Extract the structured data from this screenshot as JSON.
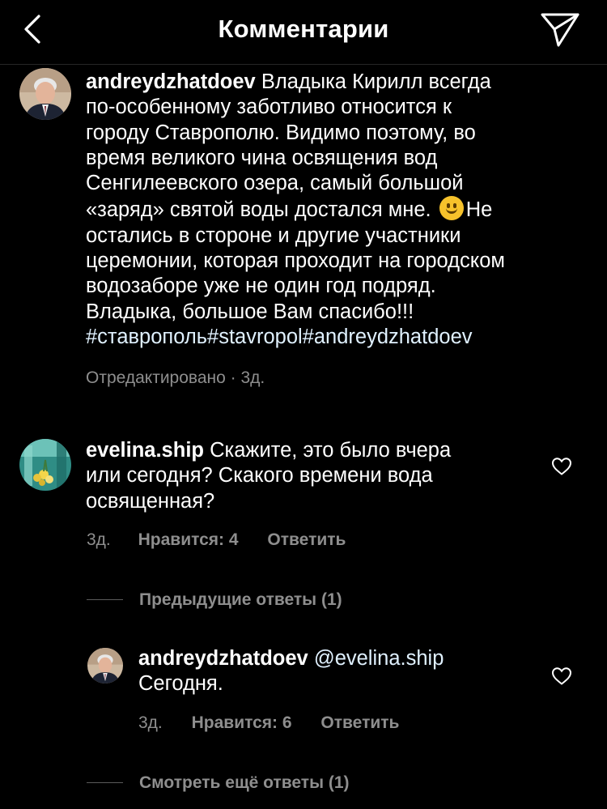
{
  "header": {
    "title": "Комментарии",
    "back_icon": "chevron-left-icon",
    "send_icon": "paper-plane-icon"
  },
  "post": {
    "username": "andreydzhatdoev",
    "text_lines": [
      "Владыка Кирилл всегда",
      "по-особенному заботливо относится к",
      "городу Ставрополю. Видимо поэтому, во",
      "время великого чина освящения вод",
      "Сенгилеевского озера, самый большой",
      "«заряд» святой воды достался мне.",
      "Не",
      "остались в стороне и другие участники",
      "церемонии, которая проходит на городском",
      "водозаборе уже не один год подряд.",
      "Владыка, большое Вам спасибо!!!"
    ],
    "hashtags": [
      "#ставрополь",
      "#stavropol",
      "#andreydzhatdoev"
    ],
    "edited": "Отредактировано",
    "time": "3д."
  },
  "comment": {
    "username": "evelina.ship",
    "text_lines": [
      "Скажите, это было вчера",
      "или сегодня? Скакого времени вода",
      "освященная?"
    ],
    "time": "3д.",
    "likes": "Нравится: 4",
    "reply": "Ответить",
    "previous_replies": "Предыдущие ответы (1)"
  },
  "reply": {
    "username": "andreydzhatdoev",
    "mention": "@evelina.ship",
    "text": "Сегодня.",
    "time": "3д.",
    "likes": "Нравится: 6",
    "reply": "Ответить",
    "more_replies": "Смотреть ещё ответы (1)"
  },
  "colors": {
    "background": "#000000",
    "text": "#ffffff",
    "secondary": "#8e8e8e",
    "hashtag": "#e0f1ff",
    "divider": "#262626"
  }
}
